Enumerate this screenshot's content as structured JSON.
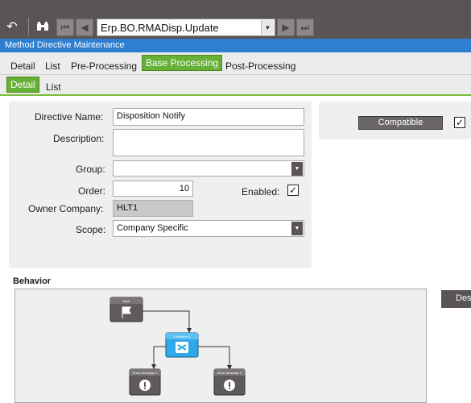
{
  "toolbar": {
    "directive_selector": "Erp.BO.RMADisp.Update"
  },
  "window_title": "Method Directive Maintenance",
  "tabs_main": [
    "Detail",
    "List",
    "Pre-Processing",
    "Base Processing",
    "Post-Processing"
  ],
  "tabs_sub": [
    "Detail",
    "List"
  ],
  "form": {
    "directive_name_label": "Directive Name:",
    "directive_name_value": "Disposition Notify",
    "description_label": "Description:",
    "description_value": "",
    "group_label": "Group:",
    "group_value": "",
    "order_label": "Order:",
    "order_value": "10",
    "enabled_label": "Enabled:",
    "owner_company_label": "Owner Company:",
    "owner_company_value": "HLT1",
    "scope_label": "Scope:",
    "scope_value": "Company Specific"
  },
  "compatible_label": "Compatible",
  "behavior": {
    "title": "Behavior",
    "designer_button": "Des",
    "nodes": [
      "Start",
      "Condition 0",
      "Show Message 1",
      "Show Message 0"
    ]
  }
}
